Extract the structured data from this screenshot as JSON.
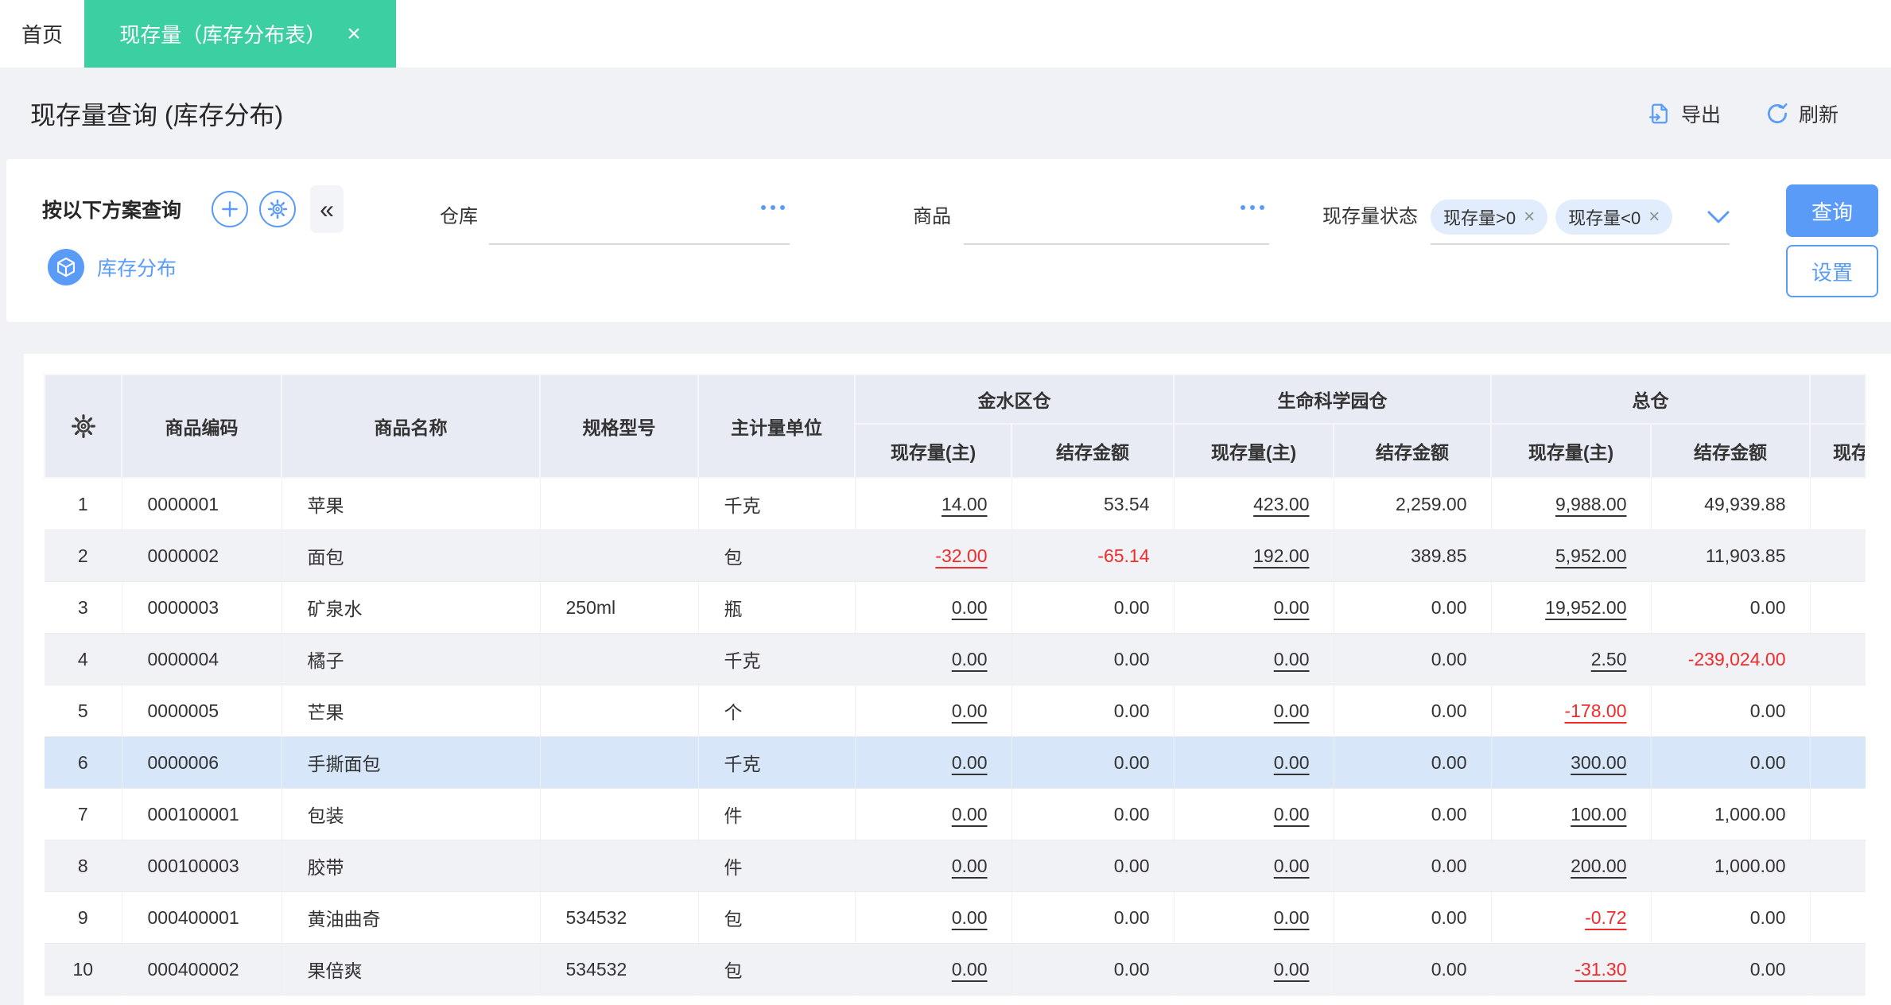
{
  "tabbar": {
    "home_tab": "首页",
    "active_tab": "现存量（库存分布表）",
    "close_icon": "×"
  },
  "page": {
    "title": "现存量查询 (库存分布)",
    "export_label": "导出",
    "refresh_label": "刷新"
  },
  "filter": {
    "panel_title": "按以下方案查询",
    "collapse_glyph": "«",
    "plan_name": "库存分布",
    "warehouse_label": "仓库",
    "product_label": "商品",
    "status_label": "现存量状态",
    "status_tags": [
      {
        "label": "现存量>0",
        "close": "×"
      },
      {
        "label": "现存量<0",
        "close": "×"
      }
    ],
    "query_button": "查询",
    "settings_button": "设置"
  },
  "table": {
    "columns": {
      "code": "商品编码",
      "name": "商品名称",
      "spec": "规格型号",
      "unit": "主计量单位"
    },
    "groups": [
      {
        "name": "金水区仓",
        "subs": [
          "现存量(主)",
          "结存金额"
        ]
      },
      {
        "name": "生命科学园仓",
        "subs": [
          "现存量(主)",
          "结存金额"
        ]
      },
      {
        "name": "总仓",
        "subs": [
          "现存量(主)",
          "结存金额"
        ]
      }
    ],
    "cut_column": {
      "group": "",
      "sub": "现存量(主)"
    },
    "rows": [
      {
        "no": "1",
        "code": "0000001",
        "name": "苹果",
        "spec": "",
        "unit": "千克",
        "selected": false,
        "cells": [
          {
            "v": "14.00",
            "u": true
          },
          {
            "v": "53.54"
          },
          {
            "v": "423.00",
            "u": true
          },
          {
            "v": "2,259.00"
          },
          {
            "v": "9,988.00",
            "u": true
          },
          {
            "v": "49,939.88"
          }
        ]
      },
      {
        "no": "2",
        "code": "0000002",
        "name": "面包",
        "spec": "",
        "unit": "包",
        "selected": false,
        "cells": [
          {
            "v": "-32.00",
            "u": true,
            "neg": true
          },
          {
            "v": "-65.14",
            "neg": true
          },
          {
            "v": "192.00",
            "u": true
          },
          {
            "v": "389.85"
          },
          {
            "v": "5,952.00",
            "u": true
          },
          {
            "v": "11,903.85"
          }
        ]
      },
      {
        "no": "3",
        "code": "0000003",
        "name": "矿泉水",
        "spec": "250ml",
        "unit": "瓶",
        "selected": false,
        "cells": [
          {
            "v": "0.00",
            "u": true
          },
          {
            "v": "0.00"
          },
          {
            "v": "0.00",
            "u": true
          },
          {
            "v": "0.00"
          },
          {
            "v": "19,952.00",
            "u": true
          },
          {
            "v": "0.00"
          }
        ]
      },
      {
        "no": "4",
        "code": "0000004",
        "name": "橘子",
        "spec": "",
        "unit": "千克",
        "selected": false,
        "cells": [
          {
            "v": "0.00",
            "u": true
          },
          {
            "v": "0.00"
          },
          {
            "v": "0.00",
            "u": true
          },
          {
            "v": "0.00"
          },
          {
            "v": "2.50",
            "u": true
          },
          {
            "v": "-239,024.00",
            "neg": true
          }
        ]
      },
      {
        "no": "5",
        "code": "0000005",
        "name": "芒果",
        "spec": "",
        "unit": "个",
        "selected": false,
        "cells": [
          {
            "v": "0.00",
            "u": true
          },
          {
            "v": "0.00"
          },
          {
            "v": "0.00",
            "u": true
          },
          {
            "v": "0.00"
          },
          {
            "v": "-178.00",
            "u": true,
            "neg": true
          },
          {
            "v": "0.00"
          }
        ]
      },
      {
        "no": "6",
        "code": "0000006",
        "name": "手撕面包",
        "spec": "",
        "unit": "千克",
        "selected": true,
        "cells": [
          {
            "v": "0.00",
            "u": true
          },
          {
            "v": "0.00"
          },
          {
            "v": "0.00",
            "u": true
          },
          {
            "v": "0.00"
          },
          {
            "v": "300.00",
            "u": true
          },
          {
            "v": "0.00"
          }
        ]
      },
      {
        "no": "7",
        "code": "000100001",
        "name": "包装",
        "spec": "",
        "unit": "件",
        "selected": false,
        "cells": [
          {
            "v": "0.00",
            "u": true
          },
          {
            "v": "0.00"
          },
          {
            "v": "0.00",
            "u": true
          },
          {
            "v": "0.00"
          },
          {
            "v": "100.00",
            "u": true
          },
          {
            "v": "1,000.00"
          }
        ]
      },
      {
        "no": "8",
        "code": "000100003",
        "name": "胶带",
        "spec": "",
        "unit": "件",
        "selected": false,
        "cells": [
          {
            "v": "0.00",
            "u": true
          },
          {
            "v": "0.00"
          },
          {
            "v": "0.00",
            "u": true
          },
          {
            "v": "0.00"
          },
          {
            "v": "200.00",
            "u": true
          },
          {
            "v": "1,000.00"
          }
        ]
      },
      {
        "no": "9",
        "code": "000400001",
        "name": "黄油曲奇",
        "spec": "534532",
        "unit": "包",
        "selected": false,
        "cells": [
          {
            "v": "0.00",
            "u": true
          },
          {
            "v": "0.00"
          },
          {
            "v": "0.00",
            "u": true
          },
          {
            "v": "0.00"
          },
          {
            "v": "-0.72",
            "u": true,
            "neg": true
          },
          {
            "v": "0.00"
          }
        ]
      },
      {
        "no": "10",
        "code": "000400002",
        "name": "果倍爽",
        "spec": "534532",
        "unit": "包",
        "selected": false,
        "cells": [
          {
            "v": "0.00",
            "u": true
          },
          {
            "v": "0.00"
          },
          {
            "v": "0.00",
            "u": true
          },
          {
            "v": "0.00"
          },
          {
            "v": "-31.30",
            "u": true,
            "neg": true
          },
          {
            "v": "0.00"
          }
        ]
      }
    ]
  },
  "colors": {
    "tab_teal": "#3CCFA2",
    "accent_blue": "#5B9BF8",
    "negative_red": "#F12A2A",
    "header_bg": "#E9EBF4",
    "selected_row_bg": "#D7E6F9",
    "alt_row_bg": "#F1F2F6"
  }
}
